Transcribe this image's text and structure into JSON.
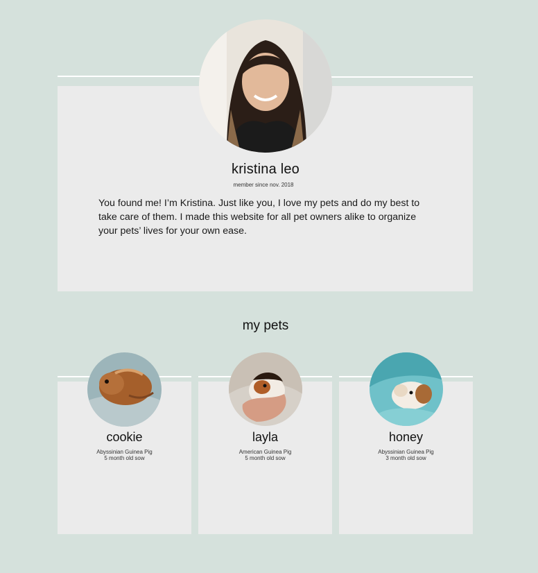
{
  "profile": {
    "name": "kristina leo",
    "member_since": "member since nov. 2018",
    "bio": "You found me! I’m Kristina.  Just like you, I love my pets and do my best to take care of them.  I made this website for all pet owners alike to organize your pets’ lives for your own ease."
  },
  "pets_section": {
    "title": "my pets",
    "pets": [
      {
        "name": "cookie",
        "breed": "Abyssinian Guinea Pig",
        "age": "5 month old sow"
      },
      {
        "name": "layla",
        "breed": "American Guinea Pig",
        "age": "5 month old sow"
      },
      {
        "name": "honey",
        "breed": "Abyssinian Guinea Pig",
        "age": "3 month old sow"
      }
    ]
  },
  "colors": {
    "background": "#d5e1dc",
    "card": "#ebebeb",
    "divider": "#ffffff"
  }
}
